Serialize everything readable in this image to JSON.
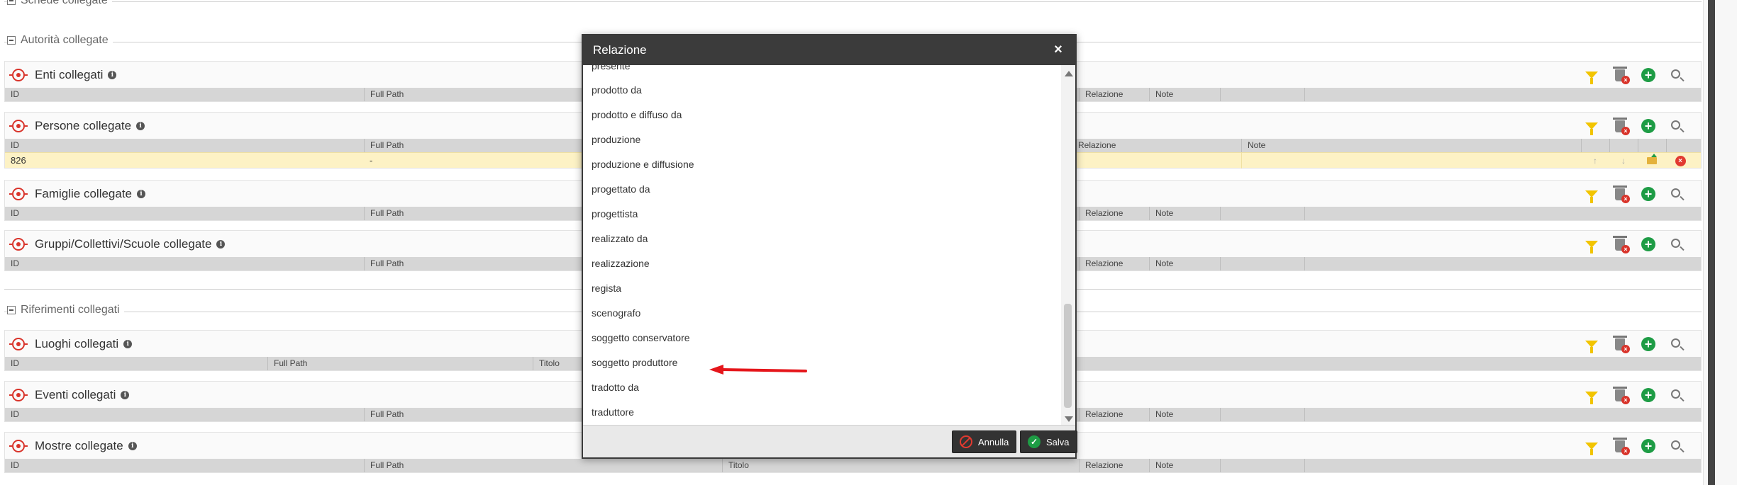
{
  "sections": {
    "schede": "Schede collegate",
    "autorita": "Autorità collegate",
    "riferimenti": "Riferimenti collegati"
  },
  "panels": {
    "enti": {
      "title": "Enti collegati",
      "cols": [
        "ID",
        "Full Path",
        "Relazione",
        "Note"
      ]
    },
    "persone": {
      "title": "Persone collegate",
      "cols": [
        "ID",
        "Full Path",
        "Relazione",
        "Note"
      ],
      "row": {
        "id": "826",
        "full_path": "-"
      }
    },
    "famiglie": {
      "title": "Famiglie collegate",
      "cols": [
        "ID",
        "Full Path",
        "Relazione",
        "Note"
      ]
    },
    "gruppi": {
      "title": "Gruppi/Collettivi/Scuole collegate",
      "cols": [
        "ID",
        "Full Path",
        "Relazione",
        "Note"
      ]
    },
    "luoghi": {
      "title": "Luoghi collegati",
      "cols": [
        "ID",
        "Full Path",
        "Titolo"
      ]
    },
    "eventi": {
      "title": "Eventi collegati",
      "cols": [
        "ID",
        "Full Path",
        "Relazione",
        "Note"
      ]
    },
    "mostre": {
      "title": "Mostre collegate",
      "cols": [
        "ID",
        "Full Path",
        "Titolo",
        "Relazione",
        "Note"
      ]
    }
  },
  "modal": {
    "title": "Relazione",
    "close": "×",
    "items": [
      "presente",
      "prodotto da",
      "prodotto e diffuso da",
      "produzione",
      "produzione e diffusione",
      "progettato da",
      "progettista",
      "realizzato da",
      "realizzazione",
      "regista",
      "scenografo",
      "soggetto conservatore",
      "soggetto produttore",
      "tradotto da",
      "traduttore"
    ],
    "cancel": "Annulla",
    "save": "Salva"
  },
  "colors": {
    "accent_red": "#d9342b",
    "add_green": "#1e9c45",
    "filter_yellow": "#f2c400",
    "selected_row": "#fdf2c5",
    "annotation_arrow": "#e5161b"
  },
  "icons": [
    "target-icon",
    "info-icon",
    "filter-icon",
    "trash-icon",
    "add-icon",
    "search-icon",
    "arrow-up-icon",
    "arrow-down-icon",
    "folder-icon",
    "remove-icon",
    "close-icon",
    "cancel-icon",
    "check-icon"
  ]
}
